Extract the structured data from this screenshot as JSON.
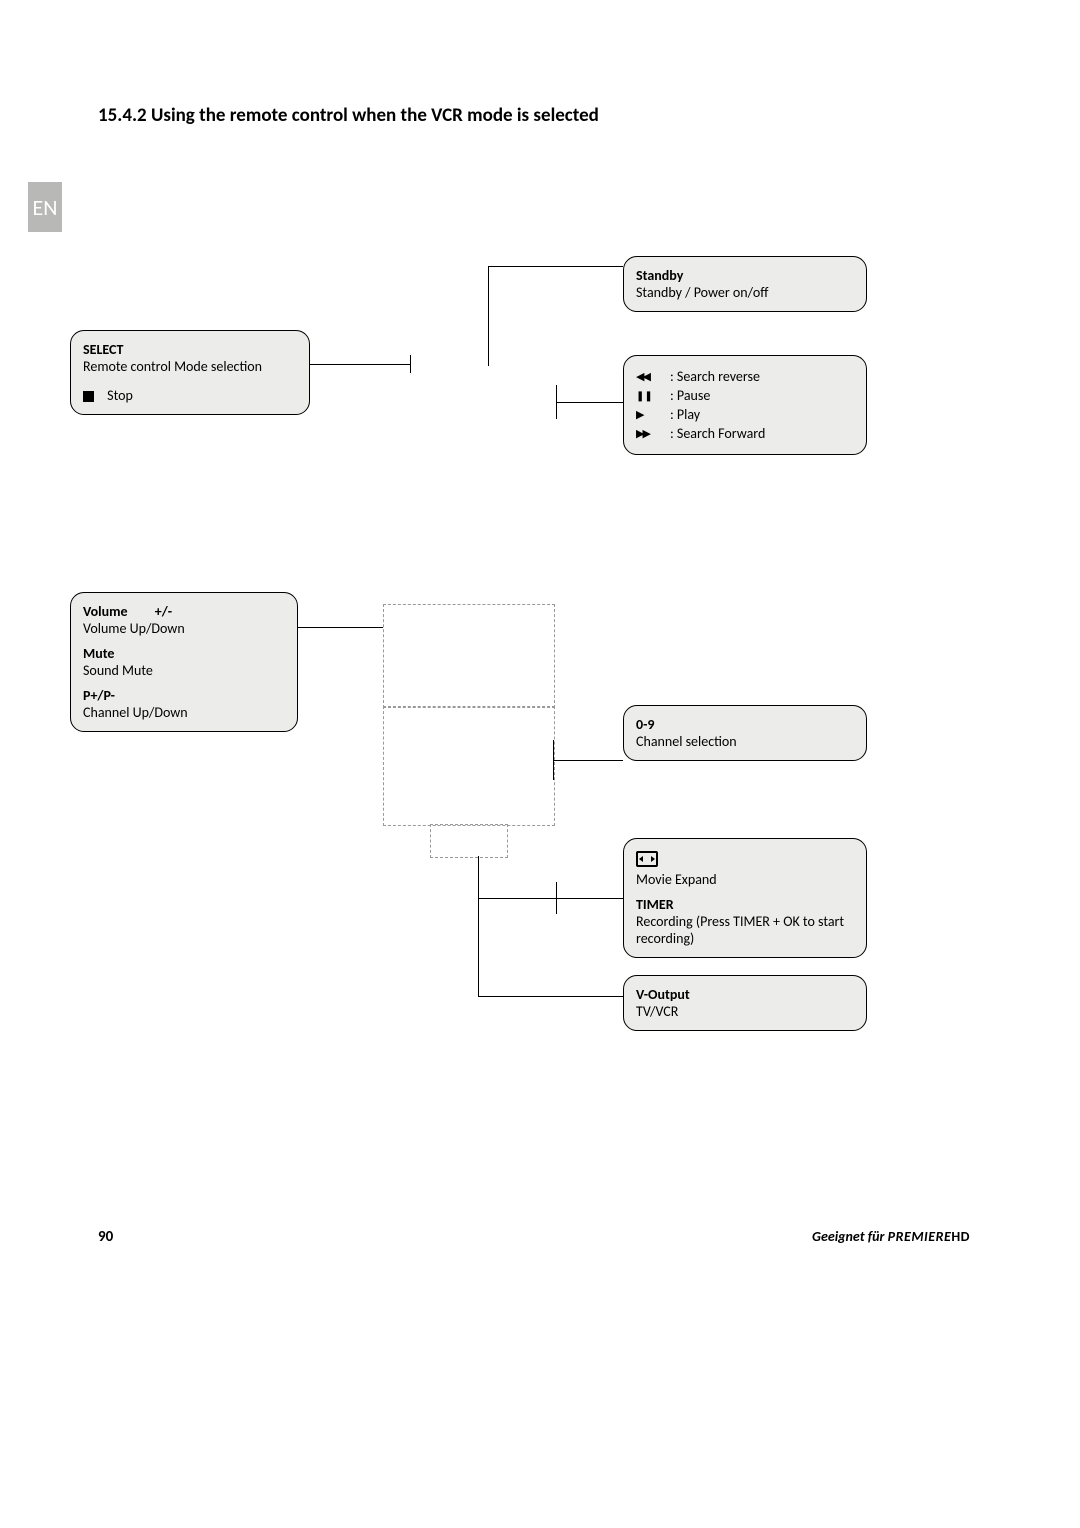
{
  "heading": "15.4.2 Using the remote control when the VCR mode is selected",
  "language_tab": "EN",
  "callouts": {
    "standby": {
      "title": "Standby",
      "desc": "Standby / Power on/off"
    },
    "select": {
      "title": "SELECT",
      "desc": "Remote control Mode selection",
      "stop_label": "Stop"
    },
    "transport": {
      "rew": ": Search reverse",
      "pause": ": Pause",
      "play": ": Play",
      "fwd": ": Search Forward"
    },
    "volume": {
      "vol_title": "Volume",
      "vol_suffix": "+/-",
      "vol_desc": "Volume Up/Down",
      "mute_title": "Mute",
      "mute_desc": "Sound Mute",
      "p_title": "P+/P-",
      "p_desc": "Channel Up/Down"
    },
    "digits": {
      "title": "0-9",
      "desc": "Channel selection"
    },
    "timer": {
      "movie_expand": "Movie Expand",
      "timer_title": "TIMER",
      "timer_desc": "Recording (Press TIMER + OK to start recording)"
    },
    "voutput": {
      "title": "V-Output",
      "desc": "TV/VCR"
    }
  },
  "footer": {
    "page_number": "90",
    "suitable_for": "Geeignet für",
    "brand": "PREMIERE",
    "brand_suffix": "HD"
  }
}
